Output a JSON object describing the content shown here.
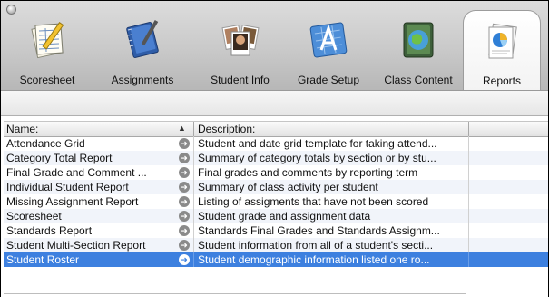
{
  "toolbar": {
    "tools": [
      {
        "label": "Scoresheet",
        "icon": "scoresheet-icon"
      },
      {
        "label": "Assignments",
        "icon": "assignments-icon"
      },
      {
        "label": "Student Info",
        "icon": "student-info-icon"
      },
      {
        "label": "Grade Setup",
        "icon": "grade-setup-icon"
      },
      {
        "label": "Class Content",
        "icon": "class-content-icon"
      },
      {
        "label": "Reports",
        "icon": "reports-icon",
        "selected": true
      }
    ]
  },
  "table": {
    "columns": {
      "name": "Name:",
      "description": "Description:"
    },
    "sort_indicator": "▲",
    "rows": [
      {
        "name": "Attendance Grid",
        "description": "Student and date grid template for taking attend..."
      },
      {
        "name": "Category Total Report",
        "description": "Summary of category totals by section or by stu..."
      },
      {
        "name": "Final Grade and Comment ...",
        "description": "Final grades and comments by reporting term"
      },
      {
        "name": "Individual Student Report",
        "description": "Summary of class activity per student"
      },
      {
        "name": "Missing Assignment Report",
        "description": "Listing of assigments that have not been scored"
      },
      {
        "name": "Scoresheet",
        "description": "Student grade and assignment data"
      },
      {
        "name": "Standards Report",
        "description": "Standards Final Grades and Standards Assignm..."
      },
      {
        "name": "Student Multi-Section Report",
        "description": "Student information from all of a student's secti..."
      },
      {
        "name": "Student Roster",
        "description": "Student demographic information listed one ro...",
        "selected": true
      }
    ]
  },
  "colors": {
    "selection": "#3d80df",
    "toolbar": "#c9c9c9",
    "alt_row": "#f1f4fa"
  }
}
